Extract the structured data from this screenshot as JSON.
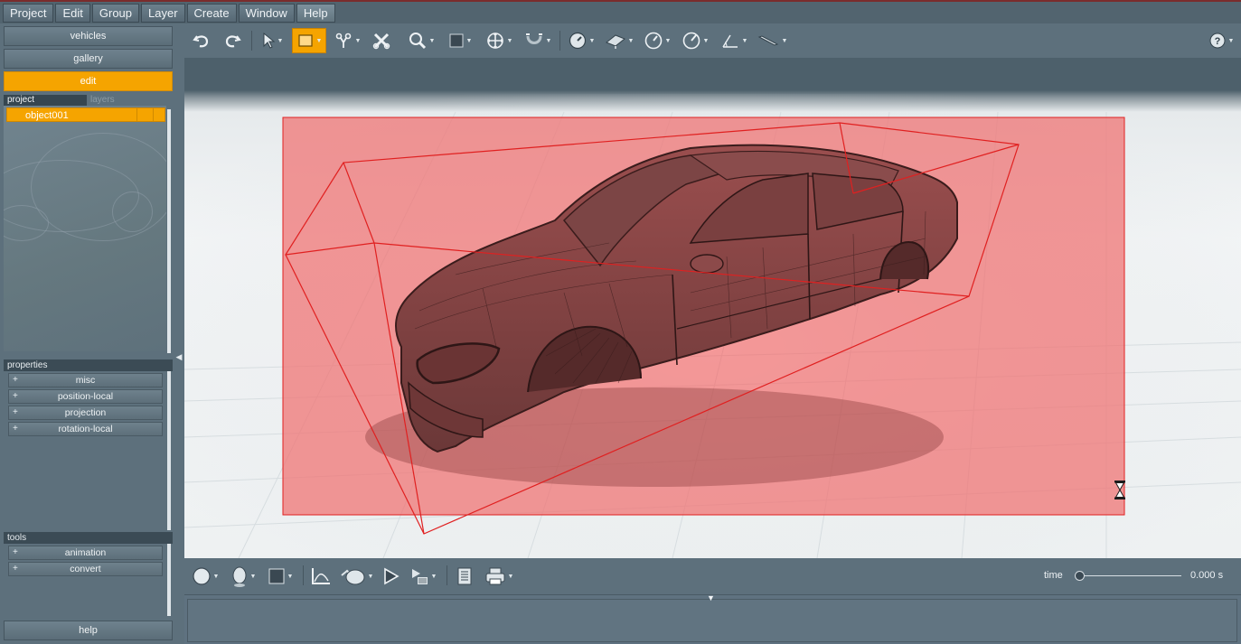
{
  "menu": [
    "Project",
    "Edit",
    "Group",
    "Layer",
    "Create",
    "Window",
    "Help"
  ],
  "nav": {
    "vehicles": "vehicles",
    "gallery": "gallery",
    "edit": "edit",
    "help": "help"
  },
  "panel_tabs": {
    "project": "project",
    "layers": "layers"
  },
  "project_items": [
    "object001"
  ],
  "properties": {
    "header": "properties",
    "items": [
      "misc",
      "position-local",
      "projection",
      "rotation-local"
    ]
  },
  "tools": {
    "header": "tools",
    "items": [
      "animation",
      "convert"
    ]
  },
  "expand_glyph": "+",
  "timeline": {
    "label": "time",
    "value": "0.000 s",
    "position": 0.0
  },
  "colors": {
    "accent": "#f5a400",
    "selection_fill": "#f07070",
    "selection_stroke": "#e02020"
  },
  "icons": {
    "toolbar": [
      "undo-icon",
      "redo-icon",
      "select-arrow-icon",
      "select-rectangle-icon",
      "lasso-icon",
      "delete-icon",
      "zoom-icon",
      "square-icon",
      "move-icon",
      "magnet-icon",
      "measure-icon",
      "plane-icon",
      "angle-icon",
      "compass-icon",
      "ruler-icon",
      "knife-icon",
      "help-icon"
    ],
    "bottom": [
      "sphere-icon",
      "head-icon",
      "square-icon",
      "graph-icon",
      "camera-icon",
      "play-icon",
      "render-queue-icon",
      "document-icon",
      "printer-icon"
    ]
  }
}
